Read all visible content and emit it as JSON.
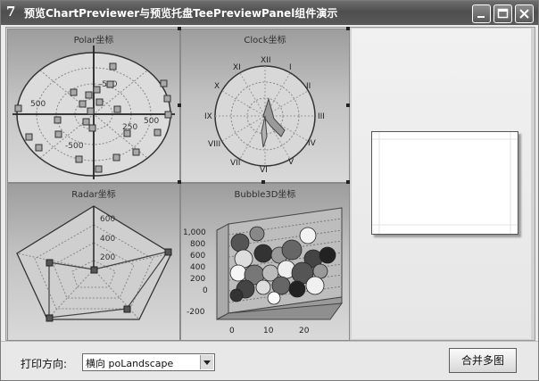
{
  "window": {
    "icon_glyph": "7",
    "title": "预览ChartPreviewer与预览托盘TeePreviewPanel组件演示",
    "controls": [
      "minimize-icon",
      "maximize-icon",
      "close-icon"
    ]
  },
  "charts": {
    "polar": {
      "title": "Polar坐标",
      "ticks": [
        "500",
        "-500",
        "500",
        "-500",
        "250"
      ]
    },
    "clock": {
      "title": "Clock坐标",
      "numerals": [
        "XII",
        "I",
        "II",
        "III",
        "IV",
        "V",
        "VI",
        "VII",
        "VIII",
        "IX",
        "X",
        "XI"
      ]
    },
    "radar": {
      "title": "Radar坐标",
      "ticks": [
        "600",
        "400",
        "200"
      ]
    },
    "bubble": {
      "title": "Bubble3D坐标",
      "y_ticks": [
        "1,000",
        "800",
        "600",
        "400",
        "200",
        "0",
        "-200"
      ],
      "x_ticks": [
        "0",
        "10",
        "20"
      ]
    }
  },
  "bottom_bar": {
    "orientation_label": "打印方向:",
    "orientation_value": "横向 poLandscape",
    "merge_button": "合并多图"
  }
}
